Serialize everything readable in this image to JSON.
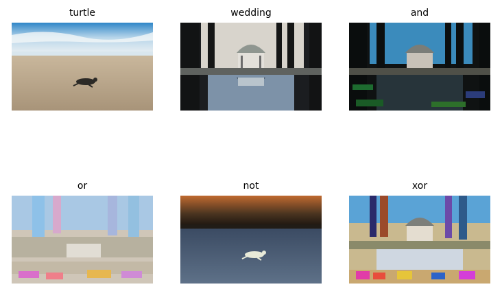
{
  "panels": [
    {
      "id": "turtle",
      "title": "turtle"
    },
    {
      "id": "wedding",
      "title": "wedding"
    },
    {
      "id": "and",
      "title": "and"
    },
    {
      "id": "or",
      "title": "or"
    },
    {
      "id": "not",
      "title": "not"
    },
    {
      "id": "xor",
      "title": "xor"
    }
  ]
}
